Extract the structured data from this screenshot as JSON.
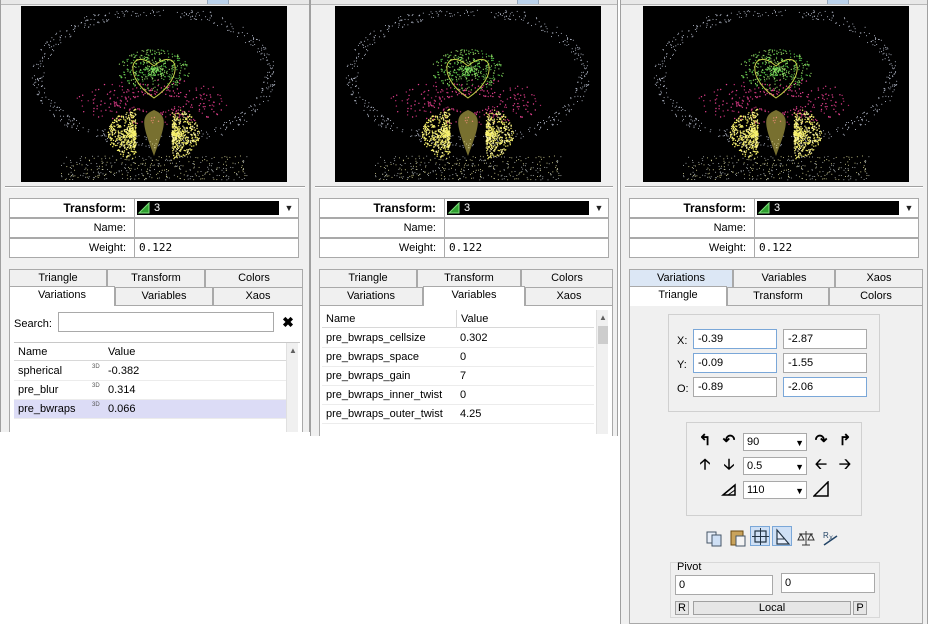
{
  "header": {
    "transform_label": "Transform:",
    "transform_value": "3",
    "name_label": "Name:",
    "name_value": "",
    "weight_label": "Weight:",
    "weight_value": "0.122"
  },
  "tabs": {
    "triangle": "Triangle",
    "transform": "Transform",
    "colors": "Colors",
    "variations": "Variations",
    "variables": "Variables",
    "xaos": "Xaos"
  },
  "variations": {
    "search_label": "Search:",
    "search_value": "",
    "clear_glyph": "✖",
    "col_name": "Name",
    "col_value": "Value",
    "badge": "3D",
    "rows": [
      {
        "name": "spherical",
        "value": "-0.382"
      },
      {
        "name": "pre_blur",
        "value": "0.314"
      },
      {
        "name": "pre_bwraps",
        "value": "0.066"
      }
    ]
  },
  "variables": {
    "col_name": "Name",
    "col_value": "Value",
    "rows": [
      {
        "name": "pre_bwraps_cellsize",
        "value": "0.302"
      },
      {
        "name": "pre_bwraps_space",
        "value": "0"
      },
      {
        "name": "pre_bwraps_gain",
        "value": "7"
      },
      {
        "name": "pre_bwraps_inner_twist",
        "value": "0"
      },
      {
        "name": "pre_bwraps_outer_twist",
        "value": "4.25"
      }
    ]
  },
  "triangle": {
    "x_label": "X:",
    "y_label": "Y:",
    "o_label": "O:",
    "x1": "-0.39",
    "x2": "-2.87",
    "y1": "-0.09",
    "y2": "-1.55",
    "o1": "-0.89",
    "o2": "-2.06",
    "rotate_angle": "90",
    "move_step": "0.5",
    "scale_percent": "110",
    "pivot_label": "Pivot",
    "pivot_x": "0",
    "pivot_y": "0",
    "reset_label": "R",
    "local_label": "Local",
    "pick_label": "P"
  },
  "colors": {
    "preview_bg": "#000000",
    "selected_row": "#dcdcf6",
    "triangle_swatch": "#3fbf3f",
    "accent": "#7aa7d8"
  }
}
